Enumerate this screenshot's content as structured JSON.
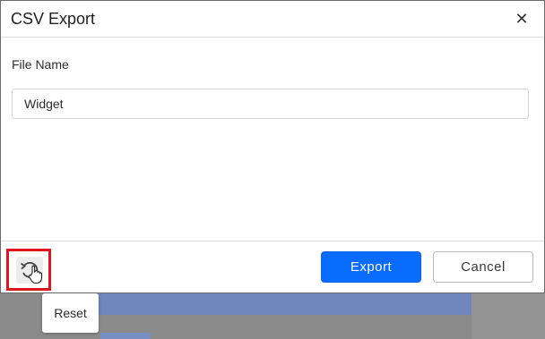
{
  "dialog": {
    "title": "CSV Export",
    "close_icon": "close-icon",
    "close_glyph": "✕"
  },
  "form": {
    "file_name_label": "File Name",
    "file_name_value": "Widget"
  },
  "footer": {
    "reset_icon": "reset-icon",
    "export_label": "Export",
    "cancel_label": "Cancel"
  },
  "tooltip": {
    "text": "Reset"
  },
  "colors": {
    "primary": "#0a6cff",
    "highlight": "#e0141e"
  }
}
